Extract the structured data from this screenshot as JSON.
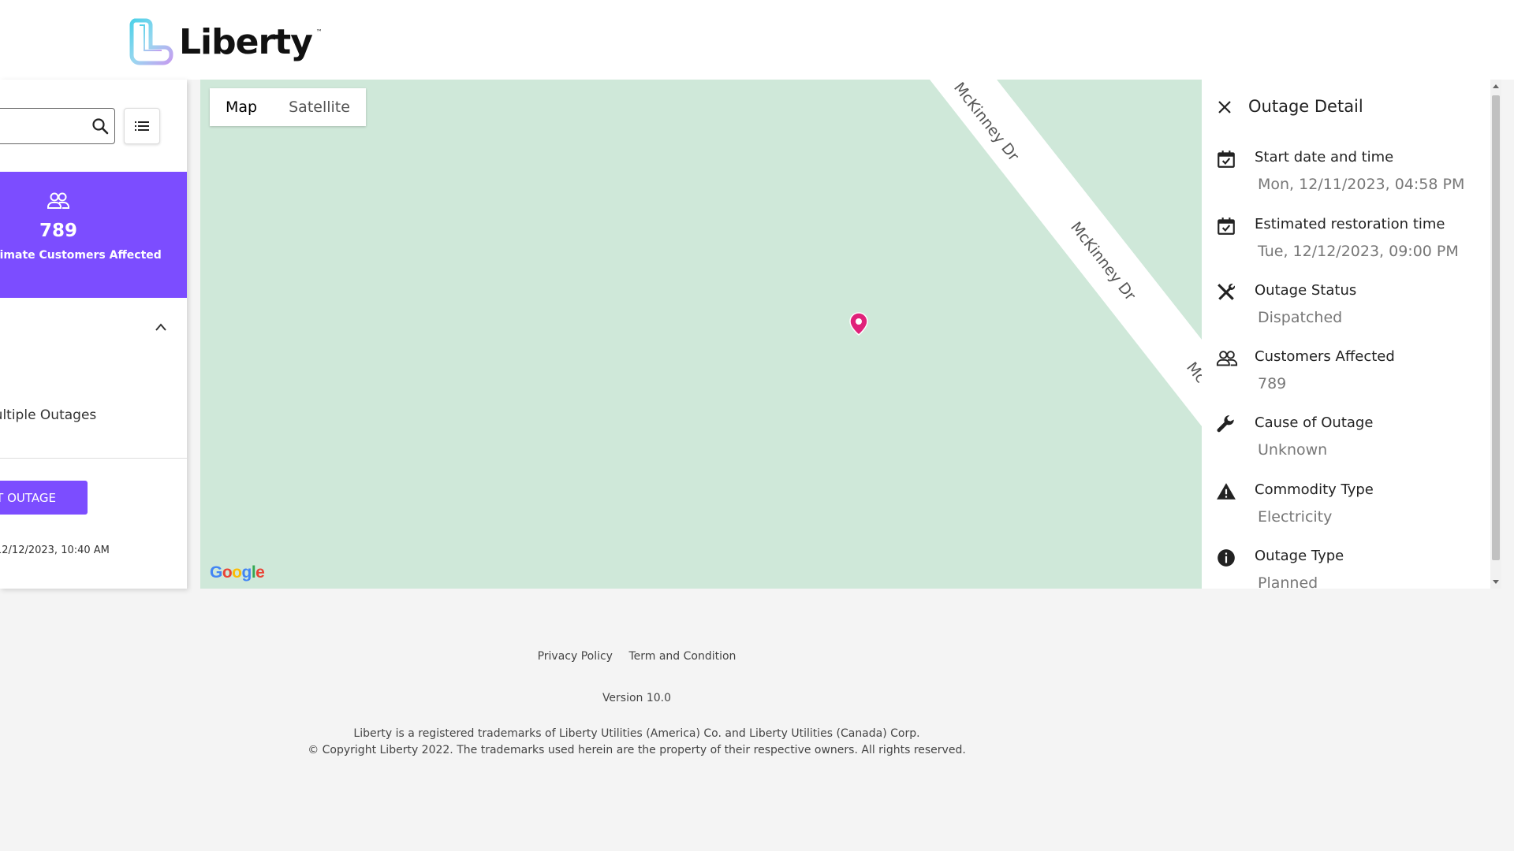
{
  "brand": {
    "name": "Liberty",
    "tm": "™"
  },
  "search": {
    "value": "",
    "placeholder": ""
  },
  "stat_card": {
    "count": "789",
    "label": "Approximate Customers Affected",
    "color": "#7c4dff"
  },
  "left_panel": {
    "outage_link": "Multiple Outages",
    "report_button": "REPORT OUTAGE",
    "updated": "12/12/2023, 10:40 AM"
  },
  "map": {
    "type_options": [
      "Map",
      "Satellite"
    ],
    "active_type": "Map",
    "street_labels": [
      "McKinney Dr",
      "McKinney Dr",
      "Mc"
    ],
    "google": "Google"
  },
  "detail": {
    "title": "Outage Detail",
    "items": [
      {
        "icon": "calendar-check-icon",
        "label": "Start date and time",
        "value": "Mon, 12/11/2023, 04:58 PM"
      },
      {
        "icon": "calendar-check-icon",
        "label": "Estimated restoration time",
        "value": "Tue, 12/12/2023, 09:00 PM"
      },
      {
        "icon": "tools-icon",
        "label": "Outage Status",
        "value": "Dispatched"
      },
      {
        "icon": "people-icon",
        "label": "Customers Affected",
        "value": "789"
      },
      {
        "icon": "wrench-icon",
        "label": "Cause of Outage",
        "value": "Unknown"
      },
      {
        "icon": "warning-icon",
        "label": "Commodity Type",
        "value": "Electricity"
      },
      {
        "icon": "info-icon",
        "label": "Outage Type",
        "value": "Planned"
      }
    ]
  },
  "footer": {
    "privacy": "Privacy Policy",
    "terms": "Term and Condition",
    "version": "Version 10.0",
    "trademark_line1": "Liberty is a registered trademarks of Liberty Utilities (America) Co. and Liberty Utilities (Canada) Corp.",
    "trademark_line2": "© Copyright Liberty 2022. The trademarks used herein are the property of their respective owners. All rights reserved."
  }
}
